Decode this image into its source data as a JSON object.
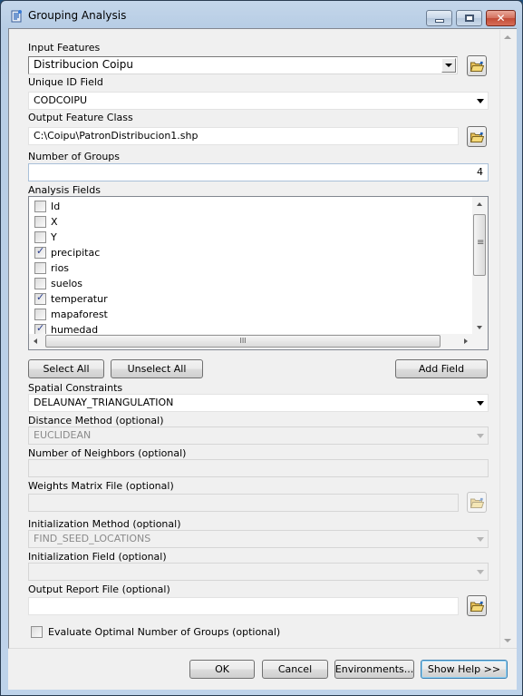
{
  "window": {
    "title": "Grouping Analysis",
    "icon": "python-script-icon",
    "controls": [
      "minimize",
      "maximize",
      "close"
    ]
  },
  "form": {
    "input_features": {
      "label": "Input Features",
      "value": "Distribucion Coipu"
    },
    "unique_id_field": {
      "label": "Unique ID Field",
      "value": "CODCOIPU"
    },
    "output_feature_class": {
      "label": "Output Feature Class",
      "value": "C:\\Coipu\\PatronDistribucion1.shp"
    },
    "number_of_groups": {
      "label": "Number of Groups",
      "value": "4"
    },
    "analysis_fields": {
      "label": "Analysis Fields",
      "items": [
        {
          "name": "Id",
          "checked": false
        },
        {
          "name": "X",
          "checked": false
        },
        {
          "name": "Y",
          "checked": false
        },
        {
          "name": "precipitac",
          "checked": true
        },
        {
          "name": "rios",
          "checked": false
        },
        {
          "name": "suelos",
          "checked": false
        },
        {
          "name": "temperatur",
          "checked": true
        },
        {
          "name": "mapaforest",
          "checked": false
        },
        {
          "name": "humedad",
          "checked": true
        }
      ]
    },
    "select_all_label": "Select All",
    "unselect_all_label": "Unselect All",
    "add_field_label": "Add Field",
    "spatial_constraints": {
      "label": "Spatial Constraints",
      "value": "DELAUNAY_TRIANGULATION"
    },
    "distance_method": {
      "label": "Distance Method (optional)",
      "value": "EUCLIDEAN"
    },
    "number_of_neighbors": {
      "label": "Number of Neighbors (optional)",
      "value": ""
    },
    "weights_matrix_file": {
      "label": "Weights Matrix File (optional)",
      "value": ""
    },
    "initialization_method": {
      "label": "Initialization Method (optional)",
      "value": "FIND_SEED_LOCATIONS"
    },
    "initialization_field": {
      "label": "Initialization Field (optional)",
      "value": ""
    },
    "output_report_file": {
      "label": "Output Report File (optional)",
      "value": ""
    },
    "evaluate_optimal": {
      "label": "Evaluate Optimal Number of Groups (optional)",
      "checked": false
    }
  },
  "footer": {
    "ok_label": "OK",
    "cancel_label": "Cancel",
    "environments_label": "Environments...",
    "show_help_label": "Show Help >>"
  }
}
